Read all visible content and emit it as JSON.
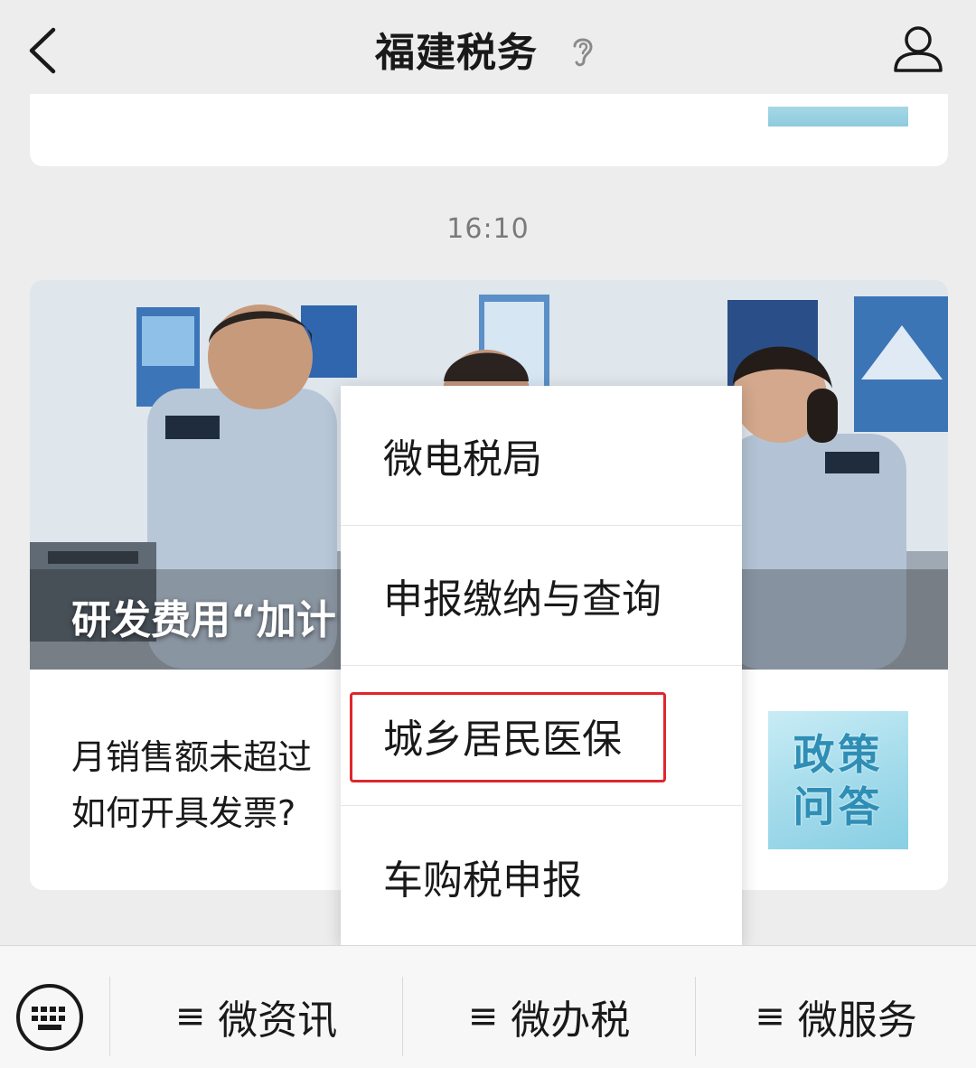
{
  "header": {
    "title": "福建税务",
    "back_icon": "chevron-left-icon",
    "listen_icon": "ear-icon",
    "profile_icon": "user-icon"
  },
  "timestamp": "16:10",
  "article": {
    "cover_title": "研发费用“加计",
    "sub_item": {
      "text_line1": "月销售额未超过",
      "text_line2": "如何开具发票?",
      "thumb_line1": "政策",
      "thumb_line2": "问答"
    }
  },
  "popup_menu": {
    "items": [
      {
        "label": "微电税局"
      },
      {
        "label": "申报缴纳与查询"
      },
      {
        "label": "城乡居民医保"
      },
      {
        "label": "车购税申报"
      }
    ],
    "highlight_color": "#e0262d"
  },
  "bottom_bar": {
    "keyboard_icon": "keyboard-icon",
    "menu_icon_glyph": "≡",
    "tabs": [
      {
        "label": "微资讯"
      },
      {
        "label": "微办税"
      },
      {
        "label": "微服务"
      }
    ]
  }
}
